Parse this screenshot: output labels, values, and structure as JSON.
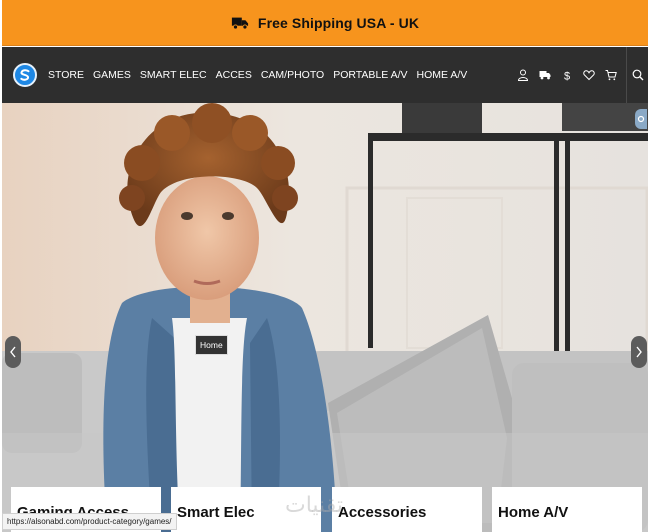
{
  "announcement": {
    "text": "Free Shipping USA - UK",
    "icon": "truck-icon"
  },
  "navbar": {
    "logo": "brand-logo",
    "links": [
      {
        "label": "STORE"
      },
      {
        "label": "GAMES"
      },
      {
        "label": "SMART ELEC"
      },
      {
        "label": "ACCES"
      },
      {
        "label": "CAM/PHOTO"
      },
      {
        "label": "PORTABLE A/V"
      },
      {
        "label": "HOME A/V"
      }
    ],
    "icons": [
      "user-icon",
      "delivery-truck-icon",
      "dollar-icon",
      "heart-icon",
      "cart-icon",
      "search-icon"
    ]
  },
  "hero": {
    "badge_label": "Home",
    "arrows": [
      "chevron-left-icon",
      "chevron-right-icon"
    ]
  },
  "categories": [
    {
      "label": "Gaming Access"
    },
    {
      "label": "Smart Elec"
    },
    {
      "label": "Accessories"
    },
    {
      "label": "Home A/V"
    }
  ],
  "status_bar": {
    "url": "https://alsonabd.com/product-category/games/"
  },
  "colors": {
    "announcement_bg": "#f7941d",
    "navbar_bg": "#2e2e2e",
    "logo_blue": "#1e88e5"
  }
}
